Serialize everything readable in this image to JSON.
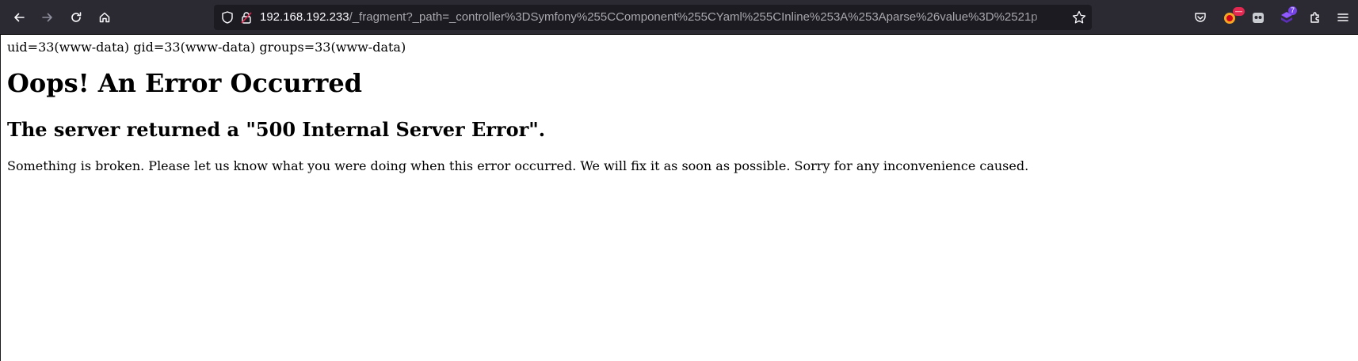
{
  "browser": {
    "url_host": "192.168.192.233",
    "url_path": "/_fragment?_path=_controller%3DSymfony%255CComponent%255CYaml%255CInline%253A%253Aparse%26value%3D%2521p",
    "extension_badge_count": "7",
    "icons": [
      "back-icon",
      "forward-icon",
      "reload-icon",
      "home-icon",
      "shield-icon",
      "lock-icon",
      "star-icon",
      "pocket-icon",
      "extension-icon",
      "extensions-icon",
      "menu-icon"
    ],
    "colors": {
      "toolbar": "#2b2a33",
      "urlbar": "#1c1b22",
      "badge": "#7542e5"
    }
  },
  "page": {
    "uid_line": "uid=33(www-data) gid=33(www-data) groups=33(www-data)",
    "title": "Oops! An Error Occurred",
    "subtitle": "The server returned a \"500 Internal Server Error\".",
    "message": "Something is broken. Please let us know what you were doing when this error occurred. We will fix it as soon as possible. Sorry for any inconvenience caused."
  }
}
